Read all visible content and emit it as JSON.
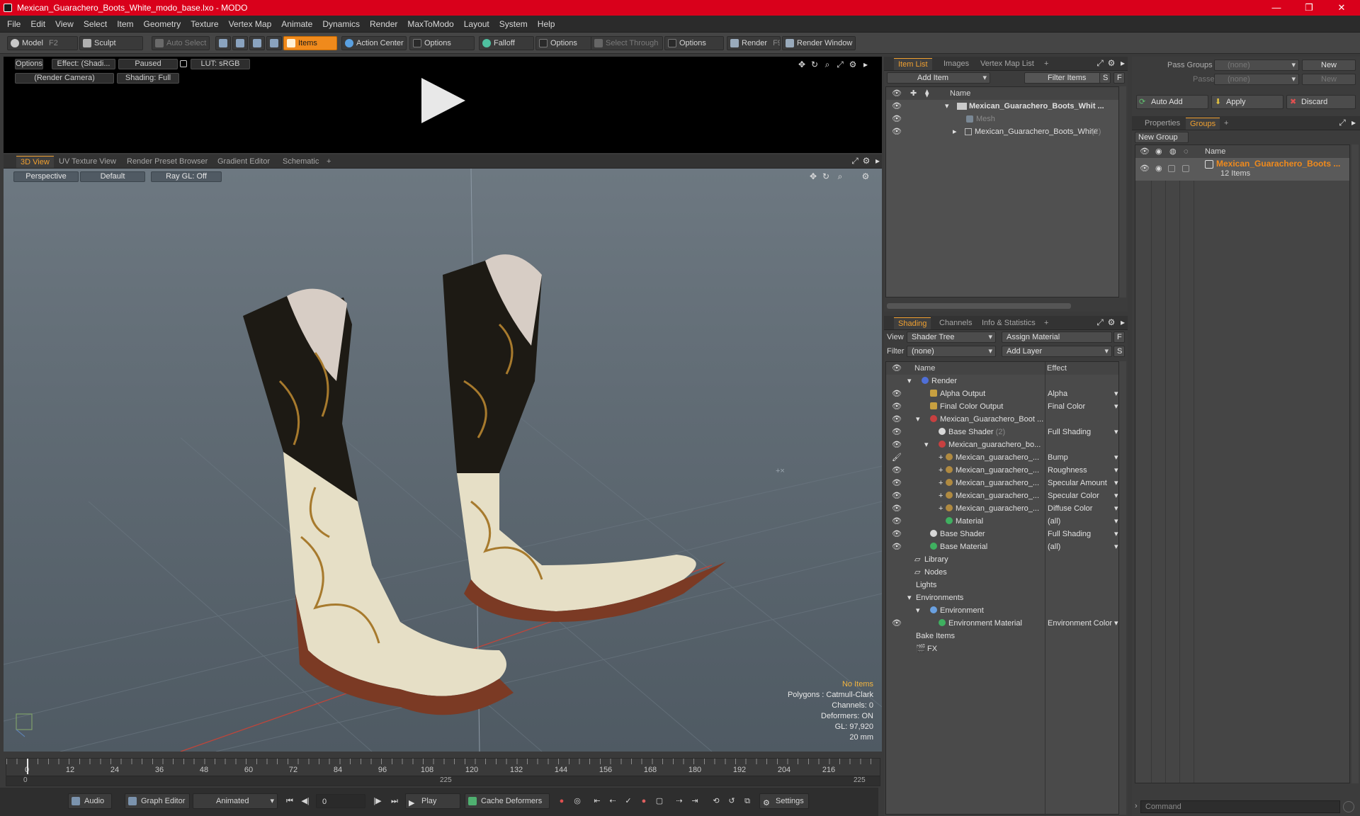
{
  "window": {
    "title": "Mexican_Guarachero_Boots_White_modo_base.lxo - MODO",
    "minimize": "—",
    "restore": "❐",
    "close": "✕"
  },
  "menu": [
    "File",
    "Edit",
    "View",
    "Select",
    "Item",
    "Geometry",
    "Texture",
    "Vertex Map",
    "Animate",
    "Dynamics",
    "Render",
    "MaxToModo",
    "Layout",
    "System",
    "Help"
  ],
  "toolbar": {
    "model": "Model",
    "model_key": "F2",
    "sculpt": "Sculpt",
    "auto_select": "Auto Select",
    "items": "Items",
    "action_center": "Action Center",
    "options1": "Options",
    "falloff": "Falloff",
    "options2": "Options",
    "select_through": "Select Through",
    "options3": "Options",
    "render": "Render",
    "render_key": "F9",
    "render_window": "Render Window"
  },
  "render_view": {
    "options": "Options",
    "effect": "Effect: (Shadi...",
    "paused": "Paused",
    "lut": "LUT: sRGB",
    "camera": "(Render Camera)",
    "shading": "Shading: Full"
  },
  "view_tabs": [
    "3D View",
    "UV Texture View",
    "Render Preset Browser",
    "Gradient Editor",
    "Schematic",
    "+"
  ],
  "viewport": {
    "perspective": "Perspective",
    "default": "Default",
    "ray_gl": "Ray GL: Off",
    "info": {
      "no_items": "No Items",
      "polygons": "Polygons : Catmull-Clark",
      "channels": "Channels: 0",
      "deformers": "Deformers: ON",
      "gl": "GL: 97,920",
      "size": "20 mm"
    }
  },
  "timeline": {
    "ticks": [
      "0",
      "12",
      "24",
      "36",
      "48",
      "60",
      "72",
      "84",
      "96",
      "108",
      "120",
      "132",
      "144",
      "156",
      "168",
      "180",
      "192",
      "204",
      "216"
    ],
    "start": "0",
    "mid": "225",
    "end": "225"
  },
  "bottom": {
    "audio": "Audio",
    "graph_editor": "Graph Editor",
    "animated": "Animated",
    "frame": "0",
    "play": "Play",
    "cache_deformers": "Cache Deformers",
    "settings": "Settings"
  },
  "item_list": {
    "tabs": [
      "Item List",
      "Images",
      "Vertex Map List",
      "+"
    ],
    "add_item": "Add Item",
    "filter_items": "Filter Items",
    "s": "S",
    "f": "F",
    "name_header": "Name",
    "rows": [
      "Mexican_Guarachero_Boots_Whit ...",
      "Mesh",
      "Mexican_Guarachero_Boots_White"
    ],
    "row_count": "(2)"
  },
  "shading": {
    "tabs": [
      "Shading",
      "Channels",
      "Info & Statistics",
      "+"
    ],
    "view_label": "View",
    "view_value": "Shader Tree",
    "assign_material": "Assign Material",
    "filter_label": "Filter",
    "filter_value": "(none)",
    "add_layer": "Add Layer",
    "f": "F",
    "s": "S",
    "name_header": "Name",
    "effect_header": "Effect",
    "rows": [
      {
        "name": "Render",
        "effect": "",
        "color": "#4f6fd8"
      },
      {
        "name": "Alpha Output",
        "effect": "Alpha",
        "color": "#c8a040"
      },
      {
        "name": "Final Color Output",
        "effect": "Final Color",
        "color": "#c8a040"
      },
      {
        "name": "Mexican_Guarachero_Boot ...",
        "effect": "",
        "color": "#c84040"
      },
      {
        "name": "Base Shader",
        "count": "(2)",
        "effect": "Full Shading",
        "color": "#d8d8d8"
      },
      {
        "name": "Mexican_guarachero_bo...",
        "effect": "",
        "color": "#c84040"
      },
      {
        "name": "Mexican_guarachero_...",
        "effect": "Bump",
        "color": "#b08a40"
      },
      {
        "name": "Mexican_guarachero_...",
        "effect": "Roughness",
        "color": "#b08a40"
      },
      {
        "name": "Mexican_guarachero_...",
        "effect": "Specular Amount",
        "color": "#b08a40"
      },
      {
        "name": "Mexican_guarachero_...",
        "effect": "Specular Color",
        "color": "#b08a40"
      },
      {
        "name": "Mexican_guarachero_...",
        "effect": "Diffuse Color",
        "color": "#b08a40"
      },
      {
        "name": "Material",
        "effect": "(all)",
        "color": "#3fb060"
      },
      {
        "name": "Base Shader",
        "effect": "Full Shading",
        "color": "#d8d8d8"
      },
      {
        "name": "Base Material",
        "effect": "(all)",
        "color": "#3fb060"
      },
      {
        "name": "Library",
        "effect": "",
        "color": ""
      },
      {
        "name": "Nodes",
        "effect": "",
        "color": ""
      },
      {
        "name": "Lights",
        "effect": "",
        "color": ""
      },
      {
        "name": "Environments",
        "effect": "",
        "color": ""
      },
      {
        "name": "Environment",
        "effect": "",
        "color": "#6aa0e0"
      },
      {
        "name": "Environment Material",
        "effect": "Environment Color",
        "color": "#3fb060"
      },
      {
        "name": "Bake Items",
        "effect": "",
        "color": ""
      },
      {
        "name": "FX",
        "effect": "",
        "color": ""
      }
    ]
  },
  "pass_groups": {
    "label": "Pass Groups",
    "value": "(none)",
    "new": "New",
    "passes_label": "Passes",
    "passes_value": "(none)",
    "passes_new": "New"
  },
  "group_actions": {
    "auto_add": "Auto Add",
    "apply": "Apply",
    "discard": "Discard"
  },
  "groups": {
    "tabs": [
      "Properties",
      "Groups",
      "+"
    ],
    "new_group": "New Group",
    "name_header": "Name",
    "item_name": "Mexican_Guarachero_Boots ...",
    "item_count": "12 Items"
  },
  "command": {
    "placeholder": "Command"
  },
  "colors": {
    "accent": "#f08a1c",
    "title_bar": "#d9001b"
  }
}
